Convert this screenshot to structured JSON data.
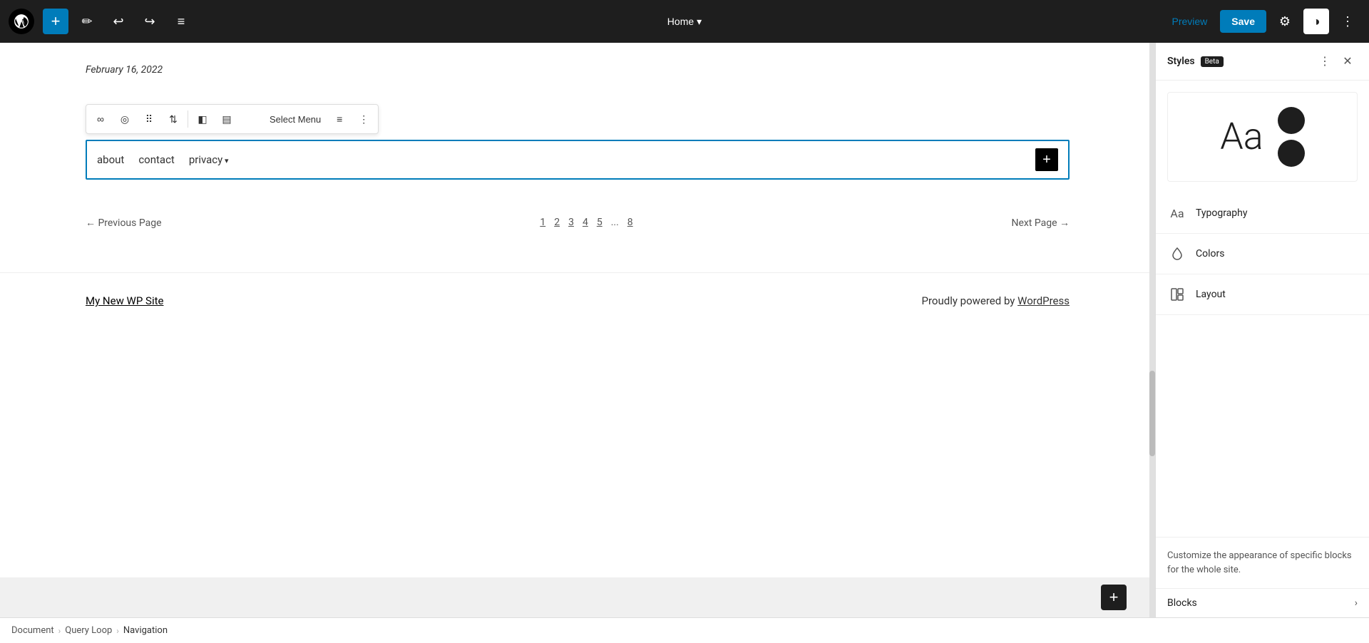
{
  "toolbar": {
    "add_label": "+",
    "undo_label": "↩",
    "redo_label": "↪",
    "list_label": "≡",
    "home_label": "Home",
    "preview_label": "Preview",
    "save_label": "Save"
  },
  "canvas": {
    "date": "February 16, 2022",
    "nav_links": [
      {
        "label": "about",
        "dropdown": false
      },
      {
        "label": "contact",
        "dropdown": false
      },
      {
        "label": "privacy",
        "dropdown": true
      }
    ],
    "pagination": {
      "prev_label": "← Previous Page",
      "next_label": "Next Page →",
      "pages": [
        "1",
        "2",
        "3",
        "4",
        "5",
        "...",
        "8"
      ]
    },
    "footer": {
      "site_name": "My New WP Site",
      "powered": "Proudly powered by ",
      "wordpress": "WordPress"
    }
  },
  "styles_panel": {
    "title": "Styles",
    "beta_label": "Beta",
    "typography_label": "Typography",
    "colors_label": "Colors",
    "layout_label": "Layout",
    "blocks_label": "Blocks",
    "description": "Customize the appearance of specific blocks for the whole site."
  },
  "breadcrumb": {
    "document": "Document",
    "query_loop": "Query Loop",
    "navigation": "Navigation"
  }
}
